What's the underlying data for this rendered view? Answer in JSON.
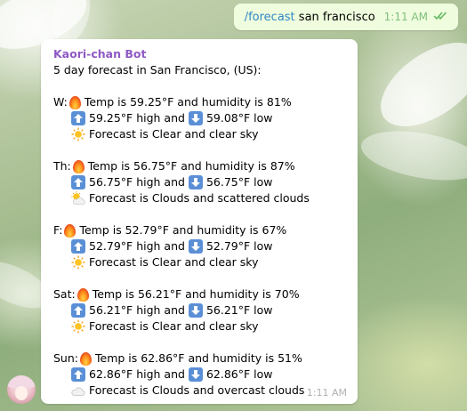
{
  "outgoing": {
    "command": "/forecast",
    "argument": "san francisco",
    "time": "1:11 AM"
  },
  "incoming": {
    "sender": "Kaori-chan Bot",
    "header": "5 day forecast in San Francisco,  (US):",
    "time": "1:11 AM",
    "days": [
      {
        "prefix": "W:",
        "temp_line": "Temp is 59.25°F and humidity is 81%",
        "high_text": "59.25°F high and",
        "low_text": "59.08°F low",
        "forecast": "Forecast is Clear and clear sky",
        "icon": "sun-icon"
      },
      {
        "prefix": "Th:",
        "temp_line": "Temp is 56.75°F and humidity is 87%",
        "high_text": "56.75°F high and",
        "low_text": "56.75°F low",
        "forecast": "Forecast is Clouds and scattered clouds",
        "icon": "sun-cloud-icon"
      },
      {
        "prefix": "F:",
        "temp_line": "Temp is 52.79°F and humidity is 67%",
        "high_text": "52.79°F high and",
        "low_text": "52.79°F low",
        "forecast": "Forecast is Clear and clear sky",
        "icon": "sun-icon"
      },
      {
        "prefix": "Sat:",
        "temp_line": "Temp is 56.21°F and humidity is 70%",
        "high_text": "56.21°F high and",
        "low_text": "56.21°F low",
        "forecast": "Forecast is Clear and clear sky",
        "icon": "sun-icon"
      },
      {
        "prefix": "Sun:",
        "temp_line": "Temp is 62.86°F and humidity is 51%",
        "high_text": "62.86°F high and",
        "low_text": "62.86°F low",
        "forecast": "Forecast is Clouds and overcast clouds",
        "icon": "cloud-icon"
      }
    ]
  },
  "colors": {
    "outgoing_bubble": "#effdde",
    "sender_name": "#8e59c4",
    "link": "#2f88c4",
    "read_check": "#5fb85f"
  }
}
